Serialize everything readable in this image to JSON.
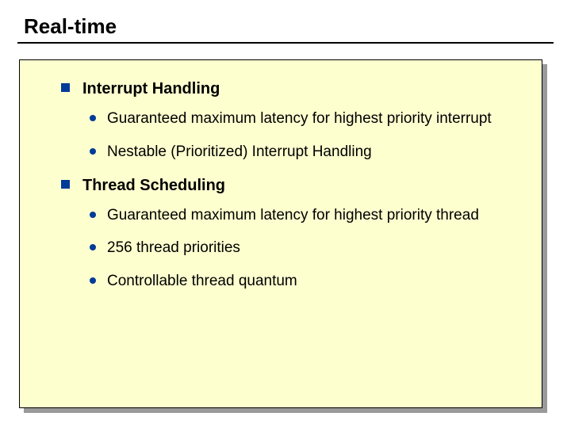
{
  "slide": {
    "title": "Real-time",
    "sections": [
      {
        "heading": "Interrupt Handling",
        "items": [
          "Guaranteed maximum latency for highest priority interrupt",
          "Nestable (Prioritized) Interrupt Handling"
        ]
      },
      {
        "heading": "Thread Scheduling",
        "items": [
          "Guaranteed maximum latency for highest priority thread",
          "256 thread priorities",
          "Controllable thread quantum"
        ]
      }
    ]
  }
}
